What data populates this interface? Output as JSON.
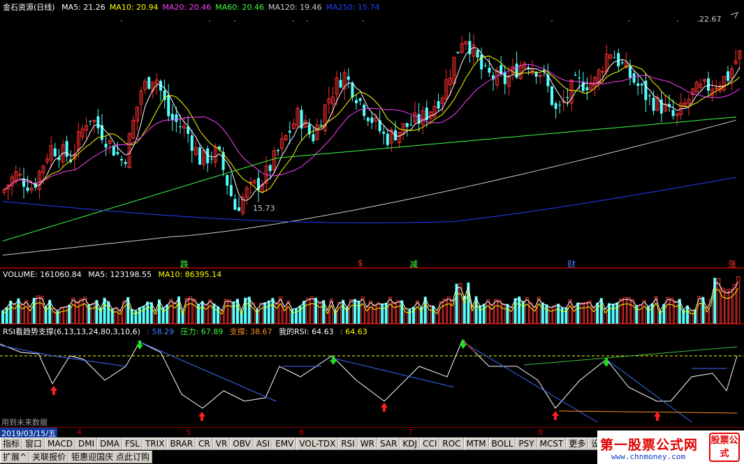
{
  "price_panel": {
    "title": "金石资源(日线)",
    "ma": [
      {
        "label": "MA5: 21.26",
        "color": "#ffffff"
      },
      {
        "label": "MA10: 20.94",
        "color": "#ffff00"
      },
      {
        "label": "MA20: 20.46",
        "color": "#ff40ff"
      },
      {
        "label": "MA60: 20.46",
        "color": "#40ff40"
      },
      {
        "label": "MA120: 19.46",
        "color": "#cccccc"
      },
      {
        "label": "MA250: 15.74",
        "color": "#2040ff"
      }
    ],
    "high_label": "22.67",
    "low_label": "15.73",
    "events": [
      {
        "text": "跌",
        "color": "#40ff40"
      },
      {
        "text": "$",
        "color": "#ff3030"
      },
      {
        "text": "减",
        "color": "#40ff40"
      },
      {
        "text": "财",
        "color": "#4080ff"
      },
      {
        "text": "涨",
        "color": "#ff3030"
      }
    ]
  },
  "volume_panel": {
    "title": "VOLUME: 161060.84",
    "ma5": "MA5: 123198.55",
    "ma10": "MA10: 86395.14"
  },
  "rsi_panel": {
    "title": "RSI看趋势支撑(6,13,13,24,80,3,10,6)",
    "v1": ": 58.29",
    "pressure": "压力: 67.89",
    "support": "支撑: 38.67",
    "my_rsi": "我的RSI: 64.63",
    "v2": ": 64.63"
  },
  "future_note": "用到未来数据",
  "date_axis": {
    "current": "2019/03/15/五",
    "ticks": [
      "4",
      "5",
      "6",
      "7",
      "8"
    ]
  },
  "tabs_row1": [
    "指标",
    "窗口",
    "MACD",
    "DMI",
    "DMA",
    "FSL",
    "TRIX",
    "BRAR",
    "CR",
    "VR",
    "OBV",
    "ASI",
    "EMV",
    "VOL-TDX",
    "RSI",
    "WR",
    "SAR",
    "KDJ",
    "CCI",
    "ROC",
    "MTM",
    "BOLL",
    "PSY",
    "MCST",
    "更多",
    "设置"
  ],
  "tabs_row2": [
    "扩展^",
    "关联报价",
    "钜惠迎国庆 点此订购"
  ],
  "brand": {
    "name": "第一股票公式网",
    "url": "www.chnmoney.com",
    "seal": "股票公式"
  },
  "chart_data": {
    "type": "candlestick",
    "title": "金石资源(日线)",
    "price_range": [
      14.5,
      23.5
    ],
    "annotated_high": 22.67,
    "annotated_low": 15.73,
    "ma_last": {
      "MA5": 21.26,
      "MA10": 20.94,
      "MA20": 20.46,
      "MA60": 20.46,
      "MA120": 19.46,
      "MA250": 15.74
    },
    "volume_last": 161060.84,
    "rsi_levels": {
      "pressure": 67.89,
      "support": 38.67,
      "my_rsi": 64.63
    }
  }
}
